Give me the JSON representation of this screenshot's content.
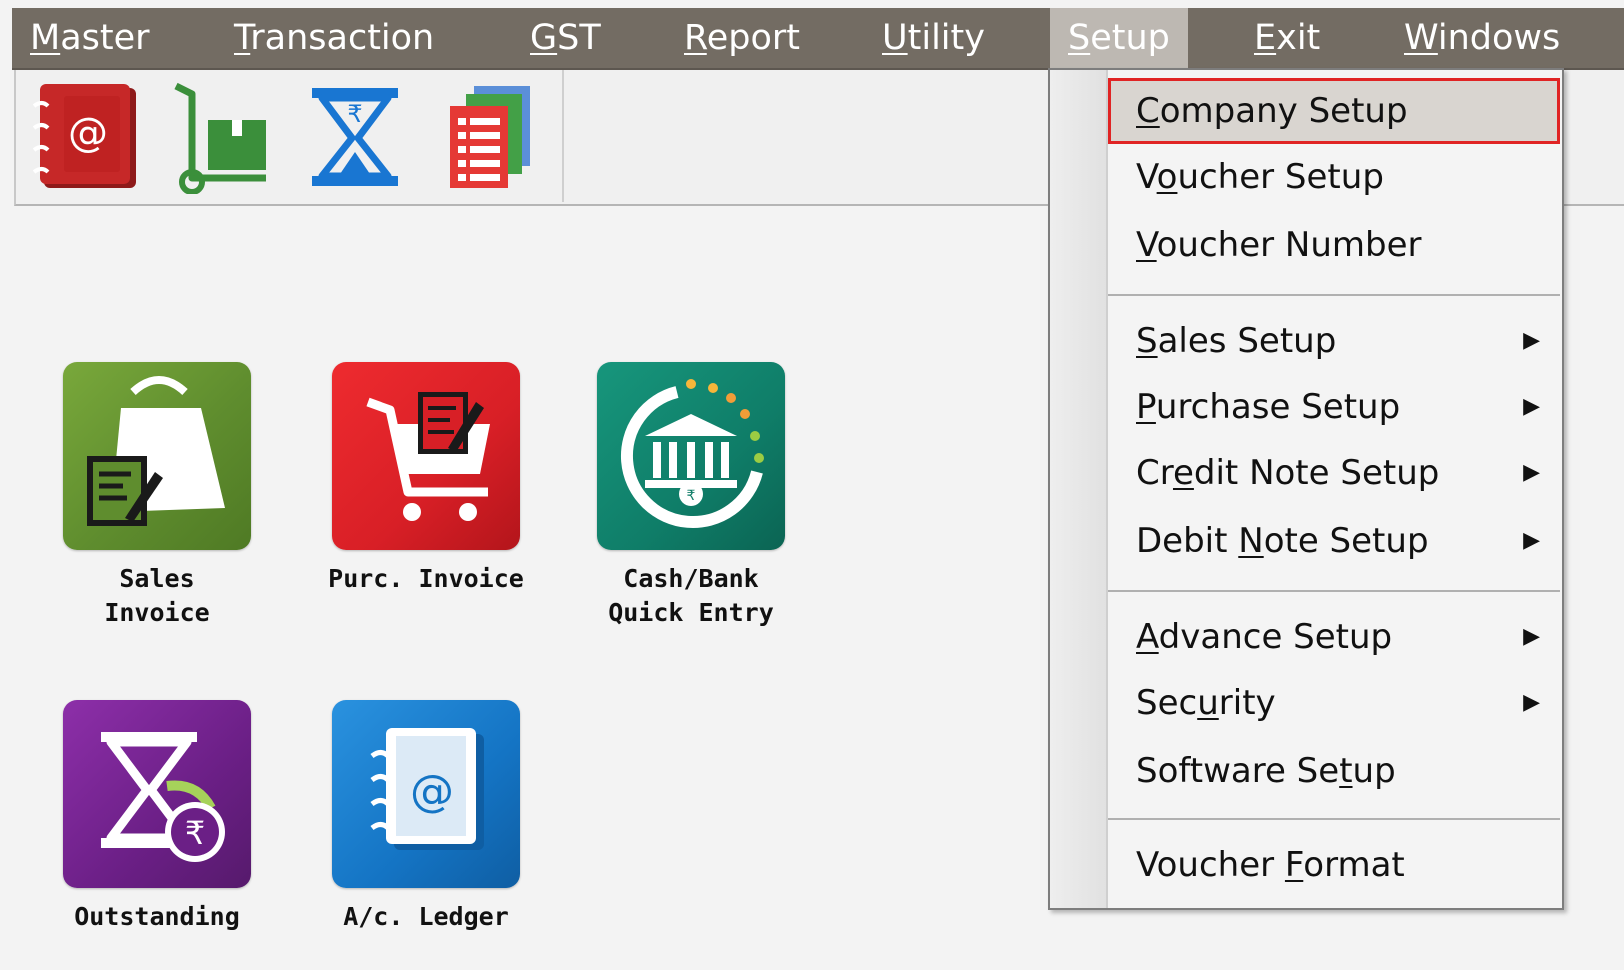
{
  "menubar": {
    "items": [
      {
        "label": "Master",
        "mnemonic": "M"
      },
      {
        "label": "Transaction",
        "mnemonic": "T"
      },
      {
        "label": "GST",
        "mnemonic": "G"
      },
      {
        "label": "Report",
        "mnemonic": "R"
      },
      {
        "label": "Utility",
        "mnemonic": "U"
      },
      {
        "label": "Setup",
        "mnemonic": "S"
      },
      {
        "label": "Exit",
        "mnemonic": "E"
      },
      {
        "label": "Windows",
        "mnemonic": "W"
      }
    ]
  },
  "toolbar": {
    "buttons": [
      {
        "icon": "address-book-icon",
        "color": "#c62828"
      },
      {
        "icon": "hand-truck-icon",
        "color": "#3b8f3b"
      },
      {
        "icon": "hourglass-rupee-icon",
        "color": "#1976d2"
      },
      {
        "icon": "stacked-documents-icon",
        "color": "#e53935"
      }
    ]
  },
  "tiles": [
    {
      "line1": "Sales",
      "line2": "Invoice",
      "icon": "shopping-bag-icon",
      "color": "#5f8d2e"
    },
    {
      "line1": "Purc. Invoice",
      "line2": "",
      "icon": "shopping-cart-icon",
      "color": "#d81f26"
    },
    {
      "line1": "Cash/Bank",
      "line2": "Quick Entry",
      "icon": "bank-icon",
      "color": "#0f7d68"
    },
    {
      "line1": "Outstanding",
      "line2": "",
      "icon": "hourglass-rupee-icon",
      "color": "#6b1f86"
    },
    {
      "line1": "A/c. Ledger",
      "line2": "",
      "icon": "address-book-icon",
      "color": "#1474c4"
    }
  ],
  "setup_menu": {
    "items": [
      {
        "label": "Company Setup",
        "mnemonic_index": 0,
        "submenu": false,
        "highlighted": true
      },
      {
        "label": "Voucher Setup",
        "mnemonic_index": 1,
        "submenu": false
      },
      {
        "label": "Voucher Number",
        "mnemonic_index": 0,
        "submenu": false
      },
      {
        "label": "Sales Setup",
        "mnemonic_index": 0,
        "submenu": true
      },
      {
        "label": "Purchase Setup",
        "mnemonic_index": 0,
        "submenu": true
      },
      {
        "label": "Credit Note Setup",
        "mnemonic_index": 2,
        "submenu": true
      },
      {
        "label": "Debit Note Setup",
        "mnemonic_index": 6,
        "submenu": true
      },
      {
        "label": "Advance Setup",
        "mnemonic_index": 0,
        "submenu": true
      },
      {
        "label": "Security",
        "mnemonic_index": 3,
        "submenu": true
      },
      {
        "label": "Software Setup",
        "mnemonic_index": 11,
        "submenu": false
      },
      {
        "label": "Voucher Format",
        "mnemonic_index": 8,
        "submenu": false
      }
    ],
    "submenu_arrow": "▶",
    "highlight_color": "#e02424"
  }
}
